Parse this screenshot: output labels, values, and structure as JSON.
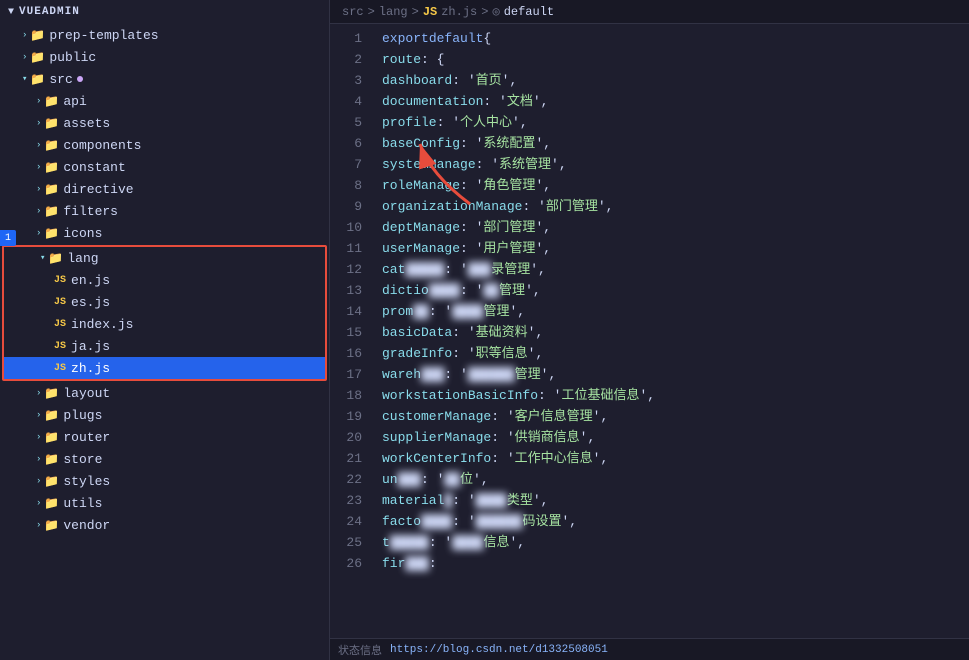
{
  "sidebar": {
    "title": "VUEADMIN",
    "items": [
      {
        "id": "prep-templates",
        "label": "prep-templates",
        "type": "folder",
        "indent": 1,
        "open": false
      },
      {
        "id": "public",
        "label": "public",
        "type": "folder",
        "indent": 1,
        "open": false
      },
      {
        "id": "src",
        "label": "src",
        "type": "folder",
        "indent": 1,
        "open": true
      },
      {
        "id": "api",
        "label": "api",
        "type": "folder",
        "indent": 2,
        "open": false
      },
      {
        "id": "assets",
        "label": "assets",
        "type": "folder",
        "indent": 2,
        "open": false
      },
      {
        "id": "components",
        "label": "components",
        "type": "folder",
        "indent": 2,
        "open": false
      },
      {
        "id": "constant",
        "label": "constant",
        "type": "folder",
        "indent": 2,
        "open": false
      },
      {
        "id": "directive",
        "label": "directive",
        "type": "folder",
        "indent": 2,
        "open": false
      },
      {
        "id": "filters",
        "label": "filters",
        "type": "folder",
        "indent": 2,
        "open": false
      },
      {
        "id": "icons",
        "label": "icons",
        "type": "folder",
        "indent": 2,
        "open": false
      },
      {
        "id": "lang",
        "label": "lang",
        "type": "folder",
        "indent": 2,
        "open": true,
        "highlight": true
      },
      {
        "id": "en.js",
        "label": "en.js",
        "type": "js",
        "indent": 3
      },
      {
        "id": "es.js",
        "label": "es.js",
        "type": "js",
        "indent": 3
      },
      {
        "id": "index.js",
        "label": "index.js",
        "type": "js",
        "indent": 3
      },
      {
        "id": "ja.js",
        "label": "ja.js",
        "type": "js",
        "indent": 3
      },
      {
        "id": "zh.js",
        "label": "zh.js",
        "type": "js",
        "indent": 3,
        "selected": true
      },
      {
        "id": "layout",
        "label": "layout",
        "type": "folder",
        "indent": 2,
        "open": false
      },
      {
        "id": "plugs",
        "label": "plugs",
        "type": "folder",
        "indent": 2,
        "open": false
      },
      {
        "id": "router",
        "label": "router",
        "type": "folder",
        "indent": 2,
        "open": false
      },
      {
        "id": "store",
        "label": "store",
        "type": "folder",
        "indent": 2,
        "open": false
      },
      {
        "id": "styles",
        "label": "styles",
        "type": "folder",
        "indent": 2,
        "open": false
      },
      {
        "id": "utils",
        "label": "utils",
        "type": "folder",
        "indent": 2,
        "open": false
      },
      {
        "id": "vendor",
        "label": "vendor",
        "type": "folder",
        "indent": 2,
        "open": false
      }
    ]
  },
  "breadcrumb": {
    "parts": [
      "src",
      "lang",
      "zh.js",
      "default"
    ]
  },
  "editor": {
    "lines": [
      {
        "n": 1,
        "code": "export default {"
      },
      {
        "n": 2,
        "code": "  route: {"
      },
      {
        "n": 3,
        "code": "    dashboard: '首页',"
      },
      {
        "n": 4,
        "code": "    documentation: '文档',"
      },
      {
        "n": 5,
        "code": "    profile: '个人中心',"
      },
      {
        "n": 6,
        "code": "    baseConfig: '系统配置',"
      },
      {
        "n": 7,
        "code": "    systemManage: '系统管理',"
      },
      {
        "n": 8,
        "code": "    roleManage: '角色管理',"
      },
      {
        "n": 9,
        "code": "    organizationManage: '部门管理',"
      },
      {
        "n": 10,
        "code": "    deptManage: '部门管理',"
      },
      {
        "n": 11,
        "code": "    userManage: '用户管理',"
      },
      {
        "n": 12,
        "code": "    cat█████: '███录管理',"
      },
      {
        "n": 13,
        "code": "    dictio████: '██管理',"
      },
      {
        "n": 14,
        "code": "    prom██: '████管理',"
      },
      {
        "n": 15,
        "code": "    basicData: '基础资料',"
      },
      {
        "n": 16,
        "code": "    gradeInfo: '职等信息',"
      },
      {
        "n": 17,
        "code": "    wareh███: '██████管理',"
      },
      {
        "n": 18,
        "code": "    workstationBasicInfo: '工位基础信息',"
      },
      {
        "n": 19,
        "code": "    customerManage: '客户信息管理',"
      },
      {
        "n": 20,
        "code": "    supplierManage: '供销商信息',"
      },
      {
        "n": 21,
        "code": "    workCenterInfo: '工作中心信息',"
      },
      {
        "n": 22,
        "code": "    un███: '██位',"
      },
      {
        "n": 23,
        "code": "    material█: '████类型',"
      },
      {
        "n": 24,
        "code": "    facto████: '██████码设置',"
      },
      {
        "n": 25,
        "code": "    t█████: '████信息',"
      },
      {
        "n": 26,
        "code": "    fir███:"
      }
    ]
  },
  "status_bar": {
    "text": "状态信息",
    "link": "https://blog.csdn.net/d1332508051"
  },
  "notification_badge": "1"
}
